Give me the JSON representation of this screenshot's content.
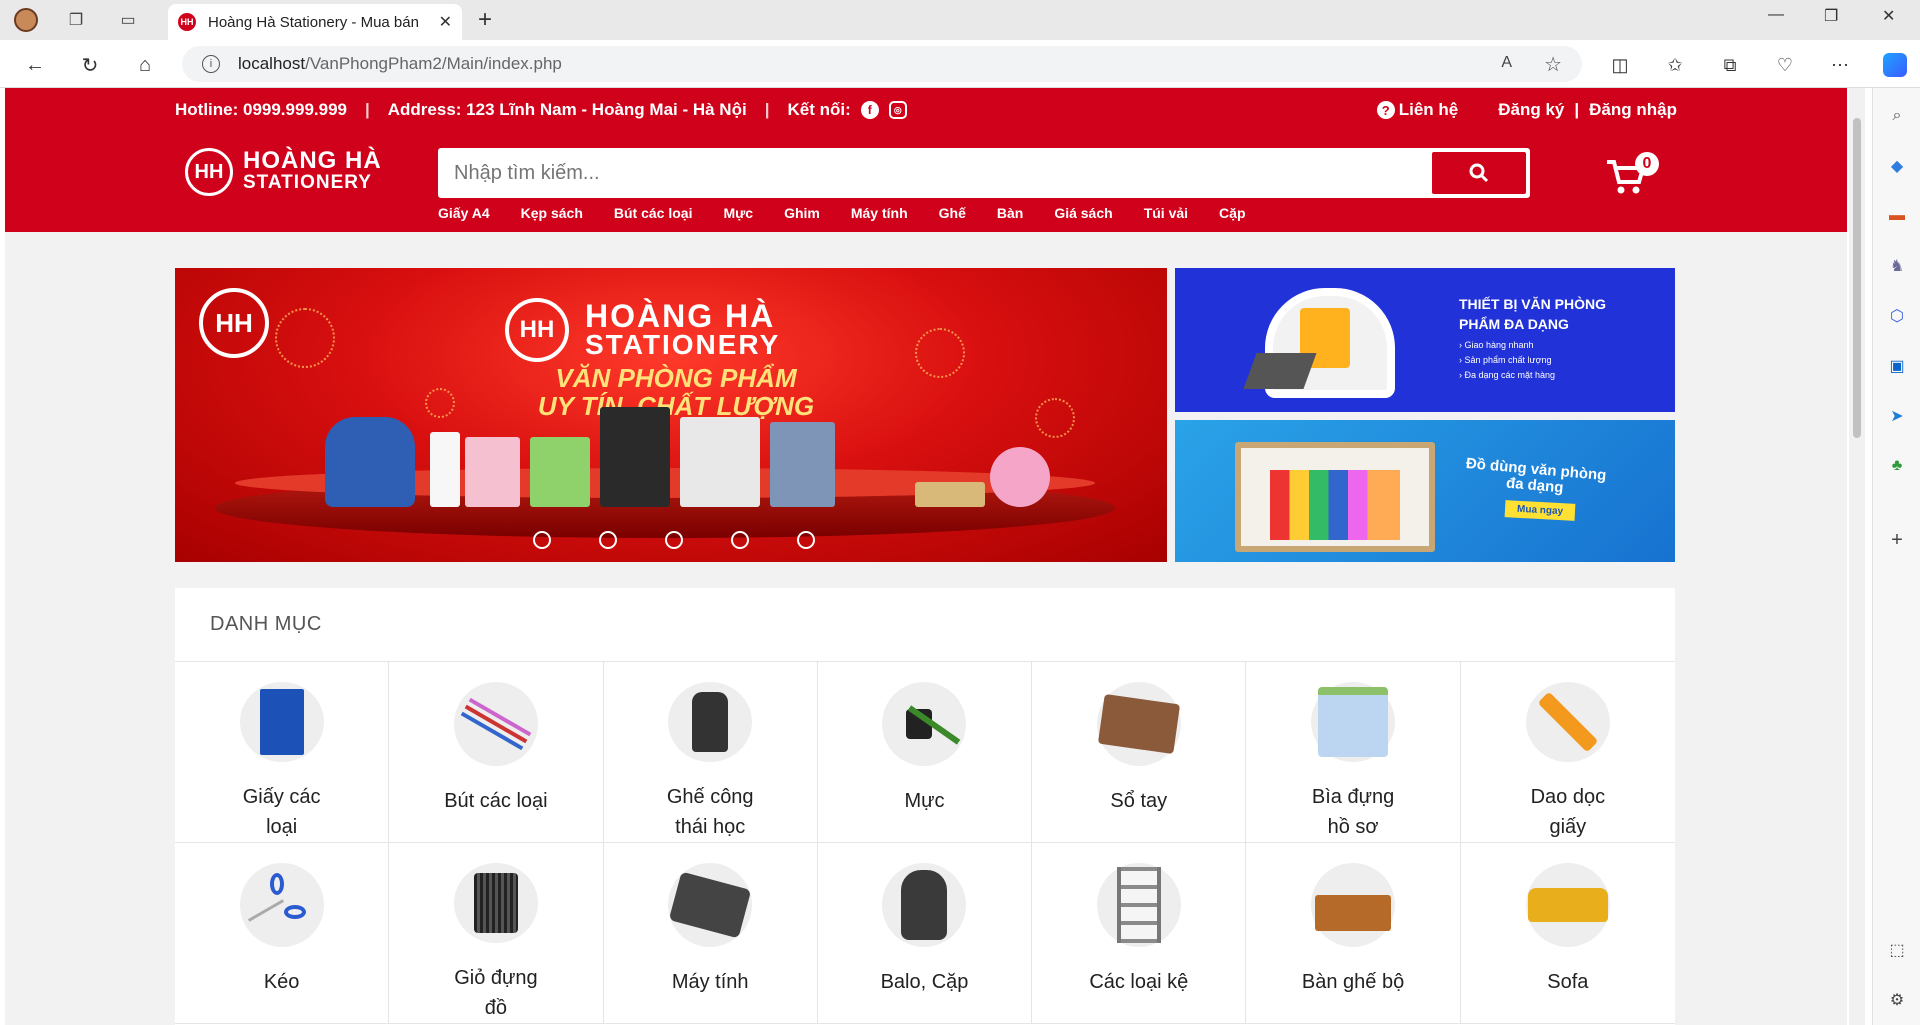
{
  "browser": {
    "tab_title": "Hoàng Hà Stationery - Mua bán",
    "url_host": "localhost",
    "url_path": "/VanPhongPham2/Main/index.php"
  },
  "topbar": {
    "hotline": "Hotline: 0999.999.999",
    "address": "Address: 123 Lĩnh Nam - Hoàng Mai - Hà Nội",
    "connect": "Kết nối:",
    "contact": "Liên hệ",
    "register": "Đăng ký",
    "login": "Đăng nhập"
  },
  "logo": {
    "mark": "HH",
    "line1": "HOÀNG HÀ",
    "line2": "STATIONERY"
  },
  "search": {
    "placeholder": "Nhập tìm kiếm..."
  },
  "cart": {
    "count": "0"
  },
  "nav": [
    "Giấy A4",
    "Kẹp sách",
    "Bút các loại",
    "Mực",
    "Ghim",
    "Máy tính",
    "Ghế",
    "Bàn",
    "Giá sách",
    "Túi vải",
    "Cặp"
  ],
  "banner_main": {
    "brand1": "HOÀNG HÀ",
    "brand2": "STATIONERY",
    "slogan1": "VĂN PHÒNG PHẨM",
    "slogan2": "UY TÍN, CHẤT LƯỢNG"
  },
  "banner_r1": {
    "title1": "THIẾT BỊ VĂN PHÒNG",
    "title2": "PHẨM ĐA DẠNG",
    "b1": "Giao hàng nhanh",
    "b2": "Sản phẩm chất lượng",
    "b3": "Đa dạng các mặt hàng"
  },
  "banner_r2": {
    "title1": "Đồ dùng văn phòng",
    "title2": "đa dạng",
    "button": "Mua ngay"
  },
  "categories": {
    "heading": "DANH MỤC",
    "items": [
      {
        "label": "Giấy các loại",
        "icon": "paper-icon"
      },
      {
        "label": "Bút các loại",
        "icon": "pen-icon"
      },
      {
        "label": "Ghế công thái học",
        "icon": "chair-icon"
      },
      {
        "label": "Mực",
        "icon": "ink-icon"
      },
      {
        "label": "Sổ tay",
        "icon": "notebook-icon"
      },
      {
        "label": "Bìa đựng hồ sơ",
        "icon": "folder-icon"
      },
      {
        "label": "Dao dọc giấy",
        "icon": "cutter-icon"
      },
      {
        "label": "Kéo",
        "icon": "scissors-icon"
      },
      {
        "label": "Giỏ đựng đồ",
        "icon": "pen-holder-icon"
      },
      {
        "label": "Máy tính",
        "icon": "calculator-icon"
      },
      {
        "label": "Balo, Cặp",
        "icon": "backpack-icon"
      },
      {
        "label": "Các loại kệ",
        "icon": "shelf-icon"
      },
      {
        "label": "Bàn ghế bộ",
        "icon": "desk-icon"
      },
      {
        "label": "Sofa",
        "icon": "sofa-icon"
      }
    ]
  }
}
